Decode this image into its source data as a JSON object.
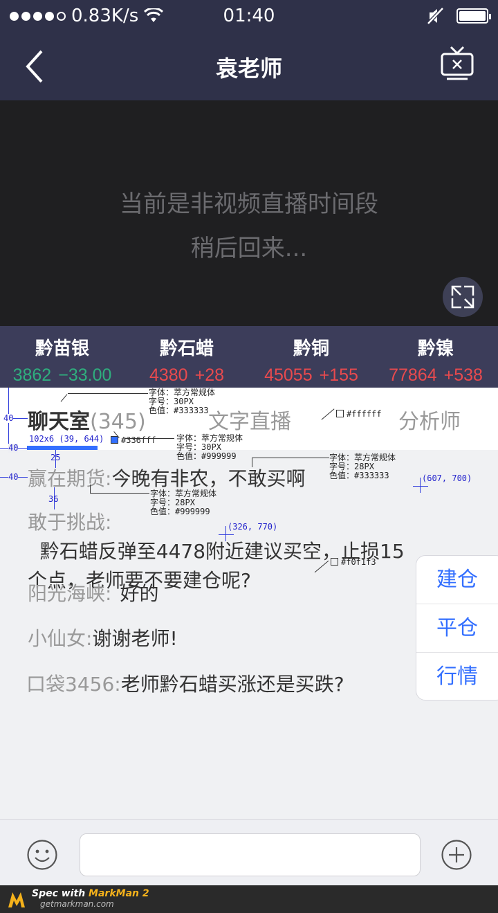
{
  "status_bar": {
    "signal_dots_filled": 4,
    "signal_dots_total": 5,
    "network_speed": "0.83K/s",
    "time": "01:40",
    "battery_level": 1.0
  },
  "nav": {
    "title": "袁老师",
    "back_icon": "chevron-left-icon",
    "tv_icon": "tv-close-icon"
  },
  "video": {
    "line1": "当前是非视频直播时间段",
    "line2": "稍后回来...",
    "fullscreen_icon": "expand-icon"
  },
  "ticker": [
    {
      "name": "黔苗银",
      "price": "3862",
      "change": "−33.00",
      "color": "#2fae7e"
    },
    {
      "name": "黔石蜡",
      "price": "4380",
      "change": "+28",
      "color": "#e84a4e"
    },
    {
      "name": "黔铜",
      "price": "45055",
      "change": "+155",
      "color": "#e84a4e"
    },
    {
      "name": "黔镍",
      "price": "77864",
      "change": "+538",
      "color": "#e84a4e"
    }
  ],
  "tabs": {
    "chat_label": "聊天室",
    "chat_count": "(345)",
    "text_live_label": "文字直播",
    "analyst_label": "分析师",
    "accent_color": "#336fff"
  },
  "messages": [
    {
      "who": "赢在期货:",
      "text": "今晚有非农，不敢买啊"
    },
    {
      "who": "敢于挑战:",
      "text": "  黔石蜡反弹至4478附近建议买空，止损15",
      "text2": "个点，老师要不要建仓呢?"
    },
    {
      "who": "阳光海峡:",
      "text": "好的"
    },
    {
      "who": "小仙女:",
      "text": "谢谢老师!"
    },
    {
      "who": "口袋3456:",
      "text": "老师黔石蜡买涨还是买跌?"
    }
  ],
  "actions": [
    "建仓",
    "平仓",
    "行情"
  ],
  "composer": {
    "placeholder": "",
    "emoji_icon": "smiley-icon",
    "plus_icon": "plus-circle-icon"
  },
  "footer": {
    "spec_with": "Spec with ",
    "brand": "MarkMan 2",
    "site": "getmarkman.com"
  },
  "annotations": {
    "font_label": "字体：",
    "font_name": "萃方常规体",
    "size_label": "字号：",
    "color_label": "色值：",
    "spec1": {
      "size": "30PX",
      "color": "#333333"
    },
    "spec2": {
      "size": "30PX",
      "color": "#999999"
    },
    "spec3": {
      "size": "28PX",
      "color": "#333333"
    },
    "spec4": {
      "size": "28PX",
      "color": "#999999"
    },
    "white_swatch": "#ffffff",
    "blue_swatch": "#336fff",
    "bg_swatch": "#f0f1f3",
    "bar_dims": "102x6 (39, 644)",
    "coord1": "(607, 700)",
    "coord2": "(326, 770)",
    "dim_40a": "40",
    "dim_40b": "40",
    "dim_40c": "40",
    "dim_25": "25",
    "dim_36": "36"
  }
}
